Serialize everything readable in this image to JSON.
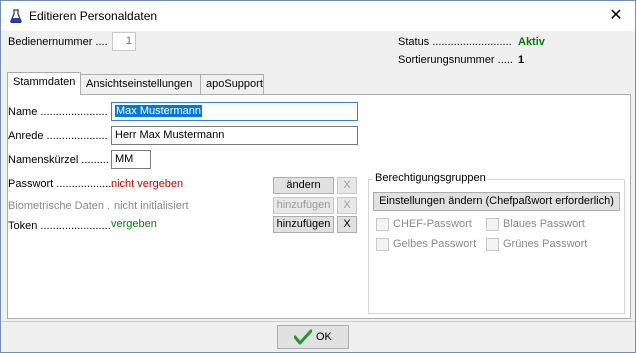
{
  "window": {
    "title": "Editieren Personaldaten",
    "close_label": "✕"
  },
  "header": {
    "bedienernummer_label": "Bedienernummer ....",
    "bedienernummer_value": "1",
    "status_label": "Status ..........................",
    "status_value": "Aktiv",
    "sortierung_label": "Sortierungsnummer .....",
    "sortierung_value": "1"
  },
  "tabs": [
    {
      "label": "Stammdaten",
      "active": true
    },
    {
      "label": "Ansichtseinstellungen",
      "active": false
    },
    {
      "label": "apoSupport",
      "active": false
    }
  ],
  "form": {
    "name_label": "Name ......................",
    "name_value": "Max Mustermann",
    "anrede_label": "Anrede ....................",
    "anrede_value": "Herr Max Mustermann",
    "kuerzel_label": "Namenskürzel .........",
    "kuerzel_value": "MM",
    "passwort_label": "Passwort ...................",
    "passwort_status": "nicht vergeben",
    "passwort_button": "ändern",
    "passwort_remove": "X",
    "bio_label": "Biometrische Daten .",
    "bio_status": "nicht initialisiert",
    "bio_button": "hinzufügen",
    "bio_remove": "X",
    "token_label": "Token .......................",
    "token_status": "vergeben",
    "token_button": "hinzufügen",
    "token_remove": "X"
  },
  "permissions": {
    "title": "Berechtigungsgruppen",
    "change_button": "Einstellungen ändern (Chefpaßwort erforderlich)",
    "checkboxes": [
      {
        "label": "CHEF-Passwort",
        "checked": false
      },
      {
        "label": "Blaues Passwort",
        "checked": false
      },
      {
        "label": "Gelbes Passwort",
        "checked": false
      },
      {
        "label": "Grünes Passwort",
        "checked": false
      }
    ]
  },
  "footer": {
    "ok_label": "OK"
  },
  "icons": {
    "app": "flask-icon",
    "ok": "checkmark-icon"
  },
  "colors": {
    "active_status": "#008000",
    "error_status": "#cc0000",
    "selection": "#0078d7"
  }
}
